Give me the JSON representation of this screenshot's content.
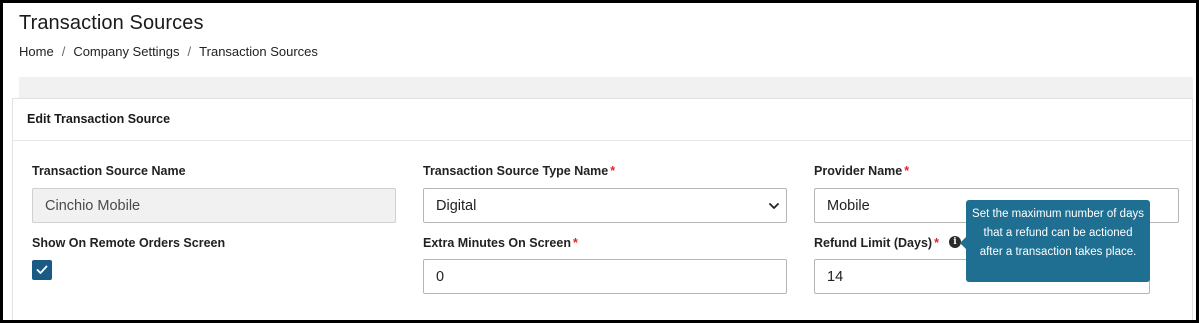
{
  "header": {
    "title": "Transaction Sources",
    "breadcrumb": [
      {
        "label": "Home"
      },
      {
        "label": "Company Settings"
      },
      {
        "label": "Transaction Sources"
      }
    ],
    "separator": "/"
  },
  "card": {
    "title": "Edit Transaction Source"
  },
  "form": {
    "source_name": {
      "label": "Transaction Source Name",
      "value": "Cinchio Mobile",
      "disabled": true
    },
    "source_type": {
      "label": "Transaction Source Type Name",
      "required_mark": "*",
      "value": "Digital"
    },
    "provider": {
      "label": "Provider Name",
      "required_mark": "*",
      "value": "Mobile"
    },
    "show_remote": {
      "label": "Show On Remote Orders Screen",
      "checked": true
    },
    "extra_minutes": {
      "label": "Extra Minutes On Screen",
      "required_mark": "*",
      "value": "0"
    },
    "refund_limit": {
      "label": "Refund Limit (Days)",
      "required_mark": "*",
      "value": "14"
    }
  },
  "tooltip": {
    "text": "Set the maximum number of days that a refund can be actioned after a transaction takes place."
  },
  "icons": {
    "info": "info-circle-icon",
    "check": "check-icon",
    "chevron": "chevron-down-icon"
  },
  "colors": {
    "checkbox": "#1b5a85",
    "tooltip_bg": "#1e6f92",
    "required": "#e0262b"
  }
}
